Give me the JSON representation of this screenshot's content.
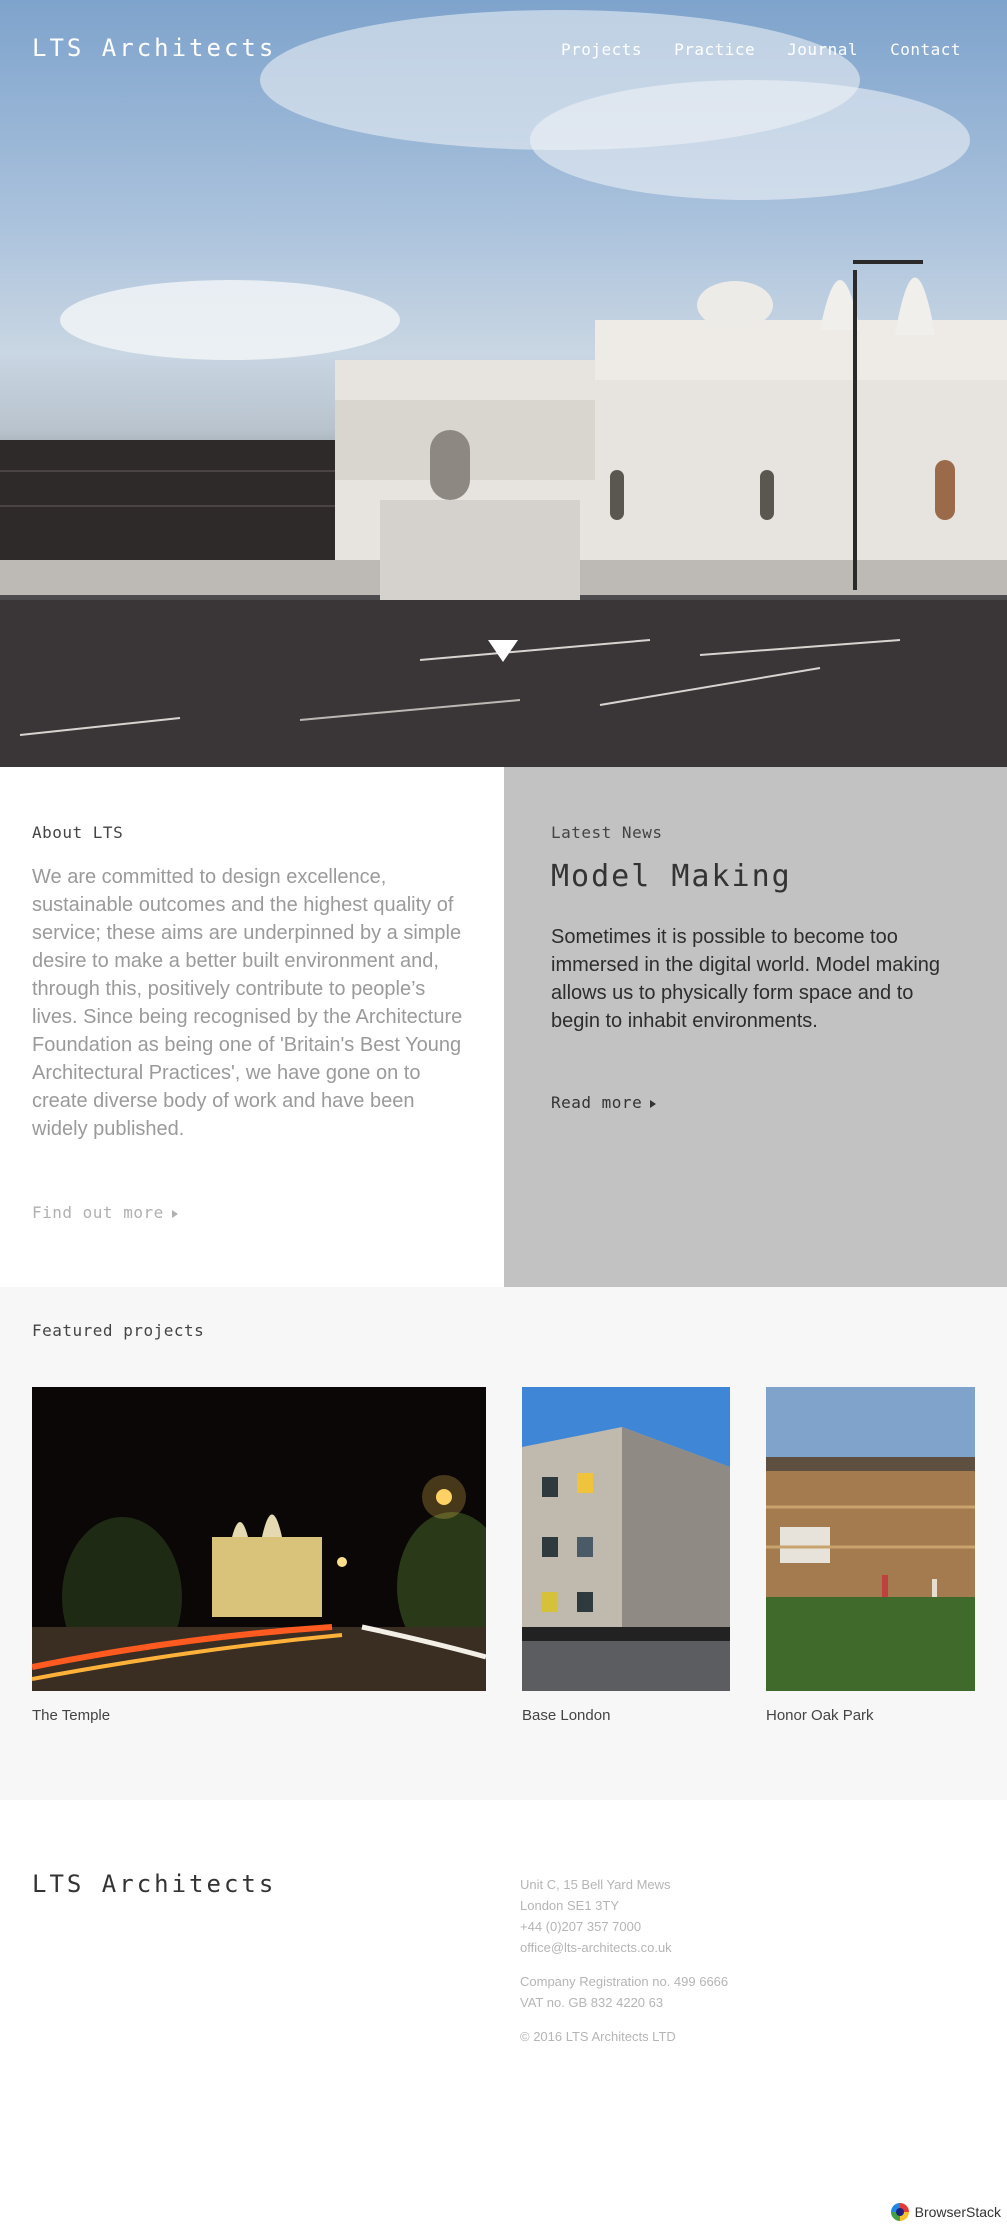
{
  "header": {
    "logo": "LTS Architects",
    "nav": [
      "Projects",
      "Practice",
      "Journal",
      "Contact"
    ]
  },
  "about": {
    "label": "About LTS",
    "text": "We are committed to design excellence, sustainable outcomes and the highest quality of service; these aims are underpinned by a simple desire to make a better built environment and, through this, positively contribute to people’s lives. Since being recognised by the Architecture Foundation as being one of 'Britain's Best Young Architectural Practices', we have gone on to create diverse body of work and have been widely published.",
    "link": "Find out more"
  },
  "news": {
    "label": "Latest News",
    "title": "Model Making",
    "text": "Sometimes it is possible to become too immersed in the digital world. Model making allows us to physically form space and to begin to inhabit environments.",
    "link": "Read more"
  },
  "featured": {
    "label": "Featured projects",
    "projects": [
      {
        "name": "The Temple"
      },
      {
        "name": "Base London"
      },
      {
        "name": "Honor Oak Park"
      }
    ]
  },
  "footer": {
    "logo": "LTS Architects",
    "address": [
      "Unit C, 15 Bell Yard Mews",
      "London SE1 3TY",
      "+44 (0)207 357 7000",
      "office@lts-architects.co.uk"
    ],
    "company": [
      "Company Registration no. 499 6666",
      "VAT no. GB 832 4220 63"
    ],
    "copyright": "© 2016 LTS Architects LTD"
  },
  "badge": {
    "label": "BrowserStack"
  },
  "colors": {
    "news_bg": "#c2c2c2",
    "featured_bg": "#f7f7f7",
    "text_muted": "#9a9a9a"
  }
}
